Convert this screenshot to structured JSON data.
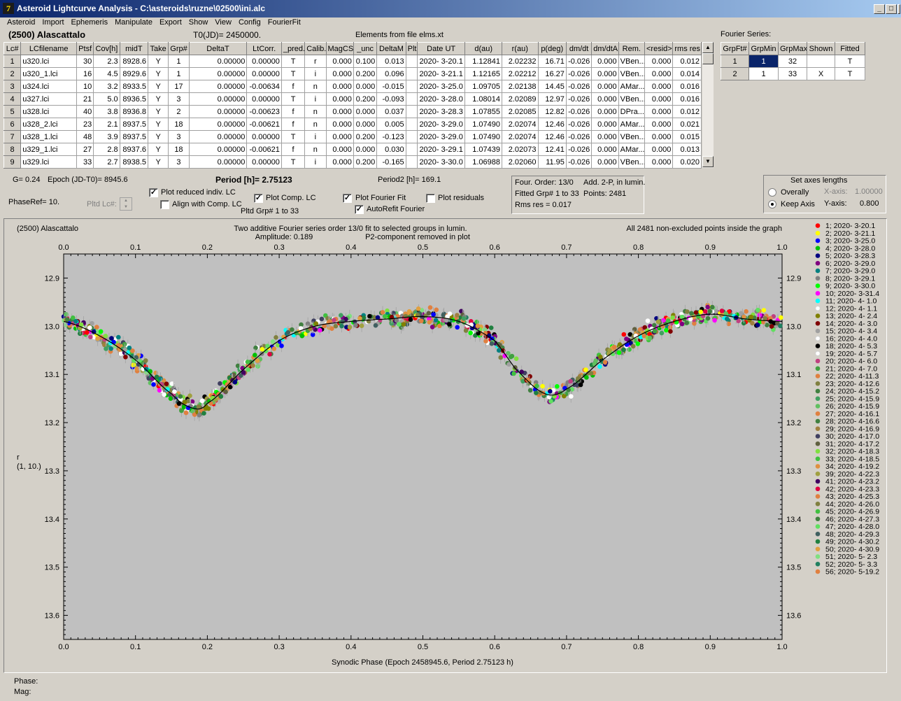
{
  "window": {
    "title": "Asteroid Lightcurve Analysis - C:\\asteroids\\ruzne\\02500\\ini.alc",
    "app_icon": "7"
  },
  "menu": [
    "Asteroid",
    "Import",
    "Ephemeris",
    "Manipulate",
    "Export",
    "Show",
    "View",
    "Config",
    "FourierFit"
  ],
  "header": {
    "asteroid": "(2500) Alascattalo",
    "t0": "T0(JD)= 2450000.",
    "elements": "Elements from file elms.xt",
    "fourier_label": "Fourier Series:"
  },
  "lc_table": {
    "columns": [
      "Lc#",
      "LCfilename",
      "Ptsf",
      "Cov[h]",
      "midT",
      "Take",
      "Grp#",
      "DeltaT",
      "LtCorr.",
      "_pred.",
      "Calib.",
      "MagCS",
      "_unc",
      "DeltaM",
      "Plt",
      "Date UT",
      "d(au)",
      "r(au)",
      "p(deg)",
      "dm/dt",
      "dm/dtA",
      "Rem.",
      "<resid>",
      "rms res"
    ],
    "rows": [
      [
        "1",
        "u320.lci",
        "30",
        "2.3",
        "8928.6",
        "Y",
        "1",
        "0.00000",
        "0.00000",
        "T",
        "r",
        "0.000",
        "0.100",
        "0.013",
        "",
        "2020- 3-20.1",
        "1.12841",
        "2.02232",
        "16.71",
        "-0.026",
        "0.000",
        "VBen...",
        "0.000",
        "0.012"
      ],
      [
        "2",
        "u320_1.lci",
        "16",
        "4.5",
        "8929.6",
        "Y",
        "1",
        "0.00000",
        "0.00000",
        "T",
        "i",
        "0.000",
        "0.200",
        "0.096",
        "",
        "2020- 3-21.1",
        "1.12165",
        "2.02212",
        "16.27",
        "-0.026",
        "0.000",
        "VBen...",
        "0.000",
        "0.014"
      ],
      [
        "3",
        "u324.lci",
        "10",
        "3.2",
        "8933.5",
        "Y",
        "17",
        "0.00000",
        "-0.00634",
        "f",
        "n",
        "0.000",
        "0.000",
        "-0.015",
        "",
        "2020- 3-25.0",
        "1.09705",
        "2.02138",
        "14.45",
        "-0.026",
        "0.000",
        "AMar...",
        "0.000",
        "0.016"
      ],
      [
        "4",
        "u327.lci",
        "21",
        "5.0",
        "8936.5",
        "Y",
        "3",
        "0.00000",
        "0.00000",
        "T",
        "i",
        "0.000",
        "0.200",
        "-0.093",
        "",
        "2020- 3-28.0",
        "1.08014",
        "2.02089",
        "12.97",
        "-0.026",
        "0.000",
        "VBen...",
        "0.000",
        "0.016"
      ],
      [
        "5",
        "u328.lci",
        "40",
        "3.8",
        "8936.8",
        "Y",
        "2",
        "0.00000",
        "-0.00623",
        "f",
        "n",
        "0.000",
        "0.000",
        "0.037",
        "",
        "2020- 3-28.3",
        "1.07855",
        "2.02085",
        "12.82",
        "-0.026",
        "0.000",
        "DPra...",
        "0.000",
        "0.012"
      ],
      [
        "6",
        "u328_2.lci",
        "23",
        "2.1",
        "8937.5",
        "Y",
        "18",
        "0.00000",
        "-0.00621",
        "f",
        "n",
        "0.000",
        "0.000",
        "0.005",
        "",
        "2020- 3-29.0",
        "1.07490",
        "2.02074",
        "12.46",
        "-0.026",
        "0.000",
        "AMar...",
        "0.000",
        "0.021"
      ],
      [
        "7",
        "u328_1.lci",
        "48",
        "3.9",
        "8937.5",
        "Y",
        "3",
        "0.00000",
        "0.00000",
        "T",
        "i",
        "0.000",
        "0.200",
        "-0.123",
        "",
        "2020- 3-29.0",
        "1.07490",
        "2.02074",
        "12.46",
        "-0.026",
        "0.000",
        "VBen...",
        "0.000",
        "0.015"
      ],
      [
        "8",
        "u329_1.lci",
        "27",
        "2.8",
        "8937.6",
        "Y",
        "18",
        "0.00000",
        "-0.00621",
        "f",
        "n",
        "0.000",
        "0.000",
        "0.030",
        "",
        "2020- 3-29.1",
        "1.07439",
        "2.02073",
        "12.41",
        "-0.026",
        "0.000",
        "AMar...",
        "0.000",
        "0.013"
      ],
      [
        "9",
        "u329.lci",
        "33",
        "2.7",
        "8938.5",
        "Y",
        "3",
        "0.00000",
        "0.00000",
        "T",
        "i",
        "0.000",
        "0.200",
        "-0.165",
        "",
        "2020- 3-30.0",
        "1.06988",
        "2.02060",
        "11.95",
        "-0.026",
        "0.000",
        "VBen...",
        "0.000",
        "0.020"
      ]
    ]
  },
  "fourier_table": {
    "columns": [
      "GrpFt#",
      "GrpMin",
      "GrpMax",
      "Shown",
      "Fitted"
    ],
    "rows": [
      [
        "1",
        "1",
        "32",
        "",
        "T"
      ],
      [
        "2",
        "1",
        "33",
        "X",
        "T"
      ]
    ]
  },
  "controls": {
    "g_value": "G= 0.24",
    "epoch": "Epoch (JD-T0)= 8945.6",
    "period": "Period [h]= 2.75123",
    "period2": "Period2 [h]= 169.1",
    "phaseref": "PhaseRef= 10.",
    "pltd_lc": "Pltd Lc#:",
    "plot_reduced": "Plot reduced indiv. LC",
    "align_comp": "Align with Comp. LC",
    "plot_comp": "Plot Comp. LC",
    "pltd_grp": "Pltd Grp#  1   to   33",
    "plot_fourier": "Plot Fourier Fit",
    "autorefit": "AutoRefit Fourier",
    "plot_residuals": "Plot residuals",
    "four_order": "Four. Order: 13/0",
    "add2p": "Add. 2-P, in lumin.",
    "fitted_grp": "Fitted Grp# 1 to 33",
    "points": "Points: 2481",
    "rms_res": "Rms res     = 0.017",
    "axes_title": "Set axes lengths",
    "overally": "Overally",
    "keep_axis": "Keep Axis",
    "xaxis_label": "X-axis:",
    "xaxis_value": "1.00000",
    "yaxis_label": "Y-axis:",
    "yaxis_value": "0.800"
  },
  "plot_text": {
    "asteroid": "(2500) Alascattalo",
    "line1": "Two additive Fourier series order 13/0 fit to selected groups in lumin.",
    "amplitude": "Amplitude: 0.189",
    "p2": "P2-component removed in plot",
    "note": "All 2481 non-excluded points inside the graph",
    "ylabel1": "r",
    "ylabel2": "(1, 10.)"
  },
  "status": {
    "phase": "Phase:",
    "mag": "Mag:"
  },
  "chart_data": {
    "type": "scatter",
    "xlabel": "Synodic Phase (Epoch 2458945.6, Period 2.75123 h)",
    "ylabel": "r",
    "xlim": [
      0,
      1
    ],
    "ylim": [
      13.65,
      12.85
    ],
    "x_ticks": [
      "0.0",
      "0.1",
      "0.2",
      "0.3",
      "0.4",
      "0.5",
      "0.6",
      "0.7",
      "0.8",
      "0.9",
      "1.0"
    ],
    "y_ticks": [
      "12.9",
      "13.0",
      "13.1",
      "13.2",
      "13.3",
      "13.4",
      "13.5",
      "13.6"
    ],
    "fourier_fit": {
      "x": [
        0.0,
        0.05,
        0.1,
        0.15,
        0.18,
        0.2,
        0.25,
        0.3,
        0.35,
        0.4,
        0.45,
        0.5,
        0.55,
        0.6,
        0.63,
        0.67,
        0.7,
        0.75,
        0.8,
        0.85,
        0.9,
        0.95,
        1.0
      ],
      "y": [
        12.99,
        13.02,
        13.07,
        13.14,
        13.17,
        13.16,
        13.09,
        13.03,
        13.0,
        12.99,
        12.985,
        12.98,
        12.99,
        13.03,
        13.09,
        13.14,
        13.13,
        13.07,
        13.02,
        12.99,
        12.975,
        12.985,
        12.99
      ]
    },
    "legend": [
      {
        "label": "1; 2020- 3-20.1",
        "color": "#ff0000"
      },
      {
        "label": "2; 2020- 3-21.1",
        "color": "#ffff00"
      },
      {
        "label": "3; 2020- 3-25.0",
        "color": "#0000ff"
      },
      {
        "label": "4; 2020- 3-28.0",
        "color": "#00c000"
      },
      {
        "label": "5; 2020- 3-28.3",
        "color": "#000080"
      },
      {
        "label": "6; 2020- 3-29.0",
        "color": "#800080"
      },
      {
        "label": "7; 2020- 3-29.0",
        "color": "#008080"
      },
      {
        "label": "8; 2020- 3-29.1",
        "color": "#808080"
      },
      {
        "label": "9; 2020- 3-30.0",
        "color": "#00ff00"
      },
      {
        "label": "10; 2020- 3-31.4",
        "color": "#ff00ff"
      },
      {
        "label": "11; 2020- 4- 1.0",
        "color": "#00ffff"
      },
      {
        "label": "12; 2020- 4- 1.1",
        "color": "#ffffff"
      },
      {
        "label": "13; 2020- 4- 2.4",
        "color": "#808000"
      },
      {
        "label": "14; 2020- 4- 3.0",
        "color": "#800000"
      },
      {
        "label": "15; 2020- 4- 3.4",
        "color": "#a0a0a0"
      },
      {
        "label": "16; 2020- 4- 4.0",
        "color": "#ffffff"
      },
      {
        "label": "18; 2020- 4- 5.3",
        "color": "#000000"
      },
      {
        "label": "19; 2020- 4- 5.7",
        "color": "#ffffff"
      },
      {
        "label": "20; 2020- 4- 6.0",
        "color": "#c04080"
      },
      {
        "label": "21; 2020- 4- 7.0",
        "color": "#40a040"
      },
      {
        "label": "22; 2020- 4-11.3",
        "color": "#e08040"
      },
      {
        "label": "23; 2020- 4-12.6",
        "color": "#808040"
      },
      {
        "label": "24; 2020- 4-15.2",
        "color": "#408040"
      },
      {
        "label": "25; 2020- 4-15.9",
        "color": "#40a060"
      },
      {
        "label": "26; 2020- 4-15.9",
        "color": "#60c060"
      },
      {
        "label": "27; 2020- 4-16.1",
        "color": "#e08040"
      },
      {
        "label": "28; 2020- 4-16.6",
        "color": "#408040"
      },
      {
        "label": "29; 2020- 4-16.9",
        "color": "#a08040"
      },
      {
        "label": "30; 2020- 4-17.0",
        "color": "#404060"
      },
      {
        "label": "31; 2020- 4-17.2",
        "color": "#606040"
      },
      {
        "label": "32; 2020- 4-18.3",
        "color": "#80e040"
      },
      {
        "label": "33; 2020- 4-18.5",
        "color": "#40c040"
      },
      {
        "label": "34; 2020- 4-19.2",
        "color": "#e09040"
      },
      {
        "label": "39; 2020- 4-22.3",
        "color": "#a0a040"
      },
      {
        "label": "41; 2020- 4-23.2",
        "color": "#400060"
      },
      {
        "label": "42; 2020- 4-23.3",
        "color": "#e00040"
      },
      {
        "label": "43; 2020- 4-25.3",
        "color": "#e08040"
      },
      {
        "label": "44; 2020- 4-26.0",
        "color": "#808040"
      },
      {
        "label": "45; 2020- 4-26.9",
        "color": "#40c040"
      },
      {
        "label": "46; 2020- 4-27.3",
        "color": "#408040"
      },
      {
        "label": "47; 2020- 4-28.0",
        "color": "#60e060"
      },
      {
        "label": "48; 2020- 4-29.3",
        "color": "#406060"
      },
      {
        "label": "49; 2020- 4-30.2",
        "color": "#208040"
      },
      {
        "label": "50; 2020- 4-30.9",
        "color": "#e0a040"
      },
      {
        "label": "51; 2020- 5- 2.3",
        "color": "#80e080"
      },
      {
        "label": "52; 2020- 5- 3.3",
        "color": "#208060"
      },
      {
        "label": "56; 2020- 5-19.2",
        "color": "#e08040"
      }
    ]
  }
}
